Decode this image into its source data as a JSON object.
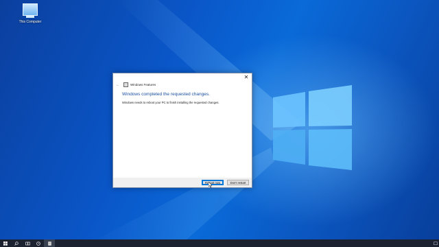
{
  "desktop": {
    "icon_label": "This Computer"
  },
  "dialog": {
    "close_glyph": "✕",
    "window_title": "Windows Features",
    "heading": "Windows completed the requested changes.",
    "message": "Windows needs to reboot your PC to finish installing the requested changes.",
    "restart_label": "Restart now",
    "dont_restart_label": "Don't restart"
  },
  "taskbar": {
    "icons": [
      "start-icon",
      "search-icon",
      "task-view-icon",
      "clock-app-icon",
      "windows-features-app-icon"
    ]
  },
  "colors": {
    "accent": "#0078d7",
    "heading": "#1a4fa0",
    "taskbar": "#1c2230"
  }
}
